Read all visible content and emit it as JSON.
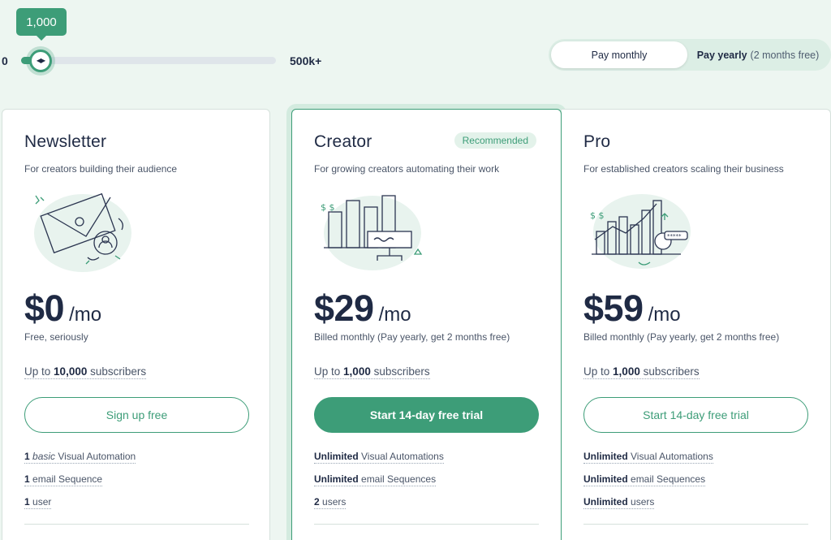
{
  "slider": {
    "value_label": "1,000",
    "min_label": "0",
    "max_label": "500k+",
    "position_fraction": 0.07
  },
  "billing_toggle": {
    "monthly_label": "Pay monthly",
    "yearly_label": "Pay yearly",
    "yearly_sub": "(2 months free)",
    "selected": "monthly"
  },
  "plans": [
    {
      "name": "Newsletter",
      "tagline": "For creators building their audience",
      "price": "$0",
      "per": "/mo",
      "billing_note": "Free, seriously",
      "subs_prefix": "Up to",
      "subs_count": "10,000",
      "subs_suffix": "subscribers",
      "cta": "Sign up free",
      "features": [
        {
          "strong": "1",
          "em": "basic",
          "text": "Visual Automation"
        },
        {
          "strong": "1",
          "em": "",
          "text": "email Sequence"
        },
        {
          "strong": "1",
          "em": "",
          "text": "user"
        }
      ]
    },
    {
      "name": "Creator",
      "badge": "Recommended",
      "tagline": "For growing creators automating their work",
      "price": "$29",
      "per": "/mo",
      "billing_note": "Billed monthly (Pay yearly, get 2 months free)",
      "subs_prefix": "Up to",
      "subs_count": "1,000",
      "subs_suffix": "subscribers",
      "cta": "Start 14-day free trial",
      "features": [
        {
          "strong": "Unlimited",
          "text": "Visual Automations"
        },
        {
          "strong": "Unlimited",
          "text": "email Sequences"
        },
        {
          "strong": "2",
          "text": "users"
        }
      ]
    },
    {
      "name": "Pro",
      "tagline": "For established creators scaling their business",
      "price": "$59",
      "per": "/mo",
      "billing_note": "Billed monthly (Pay yearly, get 2 months free)",
      "subs_prefix": "Up to",
      "subs_count": "1,000",
      "subs_suffix": "subscribers",
      "cta": "Start 14-day free trial",
      "features": [
        {
          "strong": "Unlimited",
          "text": "Visual Automations"
        },
        {
          "strong": "Unlimited",
          "text": "email Sequences"
        },
        {
          "strong": "Unlimited",
          "text": "users"
        }
      ]
    }
  ],
  "colors": {
    "accent": "#3d9d78",
    "background": "#edf6f1",
    "text": "#1f2a44"
  }
}
